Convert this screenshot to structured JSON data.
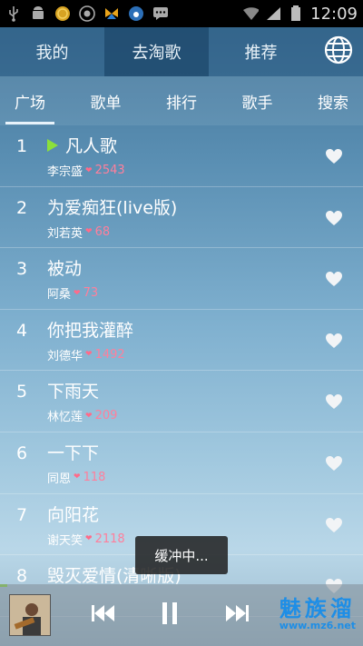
{
  "status_bar": {
    "time": "12:09",
    "left_icons": [
      "usb-icon",
      "android-icon",
      "coin-icon",
      "settings-circle-icon",
      "butterfly-icon",
      "paw-circle-icon",
      "chat-icon"
    ],
    "right_icons": [
      "wifi-icon",
      "signal-icon",
      "battery-icon"
    ]
  },
  "top_tabs": [
    {
      "label": "我的"
    },
    {
      "label": "去淘歌"
    },
    {
      "label": "推荐"
    }
  ],
  "top_tabs_active": 1,
  "sub_tabs": [
    {
      "label": "广场"
    },
    {
      "label": "歌单"
    },
    {
      "label": "排行"
    },
    {
      "label": "歌手"
    },
    {
      "label": "搜索"
    }
  ],
  "sub_tabs_active": 0,
  "songs": [
    {
      "rank": "1",
      "title": "凡人歌",
      "artist": "李宗盛",
      "likes": "2543",
      "playing": true
    },
    {
      "rank": "2",
      "title": "为爱痴狂(live版)",
      "artist": "刘若英",
      "likes": "68",
      "playing": false
    },
    {
      "rank": "3",
      "title": "被动",
      "artist": "阿桑",
      "likes": "73",
      "playing": false
    },
    {
      "rank": "4",
      "title": "你把我灌醉",
      "artist": "刘德华",
      "likes": "1492",
      "playing": false
    },
    {
      "rank": "5",
      "title": "下雨天",
      "artist": "林忆莲",
      "likes": "209",
      "playing": false
    },
    {
      "rank": "6",
      "title": "一下下",
      "artist": "同恩",
      "likes": "118",
      "playing": false
    },
    {
      "rank": "7",
      "title": "向阳花",
      "artist": "谢天笑",
      "likes": "2118",
      "playing": false
    },
    {
      "rank": "8",
      "title": "毁灭爱情(清晰版)",
      "artist": "",
      "likes": "",
      "playing": false
    }
  ],
  "toast": "缓冲中...",
  "watermark": {
    "text": "魅族溜",
    "url": "www.mz6.net"
  },
  "colors": {
    "accent_green": "#8be03a",
    "like_pink": "#ff7f9c",
    "watermark_blue": "#1e8ee6"
  }
}
